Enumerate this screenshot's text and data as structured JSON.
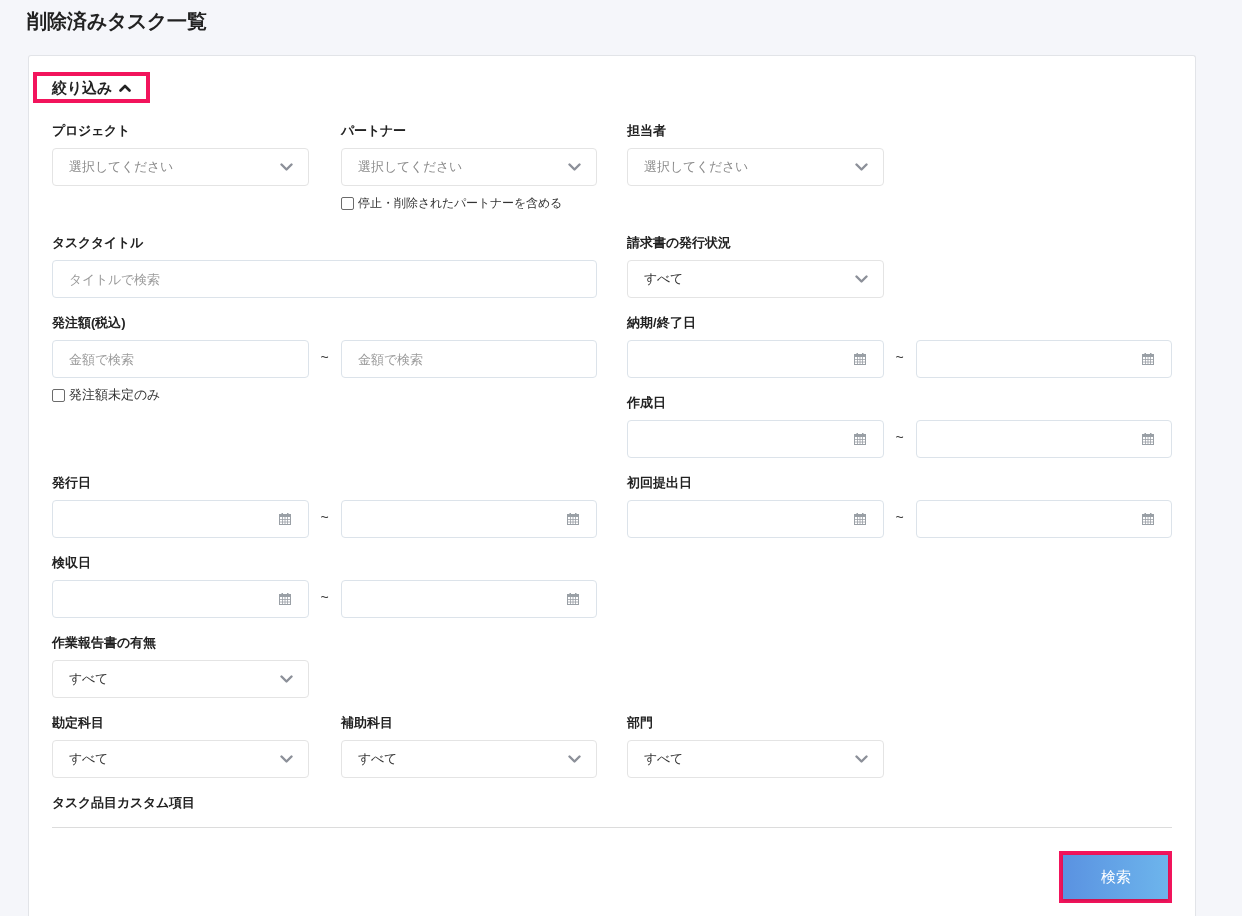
{
  "page_title": "削除済みタスク一覧",
  "filter_panel": {
    "toggle": {
      "label": "絞り込み",
      "expanded": true,
      "highlighted": true
    },
    "rows": [
      {
        "left": [
          {
            "kind": "select",
            "label": "プロジェクト",
            "placeholder": "選択してください"
          },
          {
            "kind": "select",
            "label": "パートナー",
            "placeholder": "選択してください",
            "option": {
              "label": "停止・削除されたパートナーを含める",
              "checked": false
            }
          }
        ],
        "right": [
          {
            "kind": "select",
            "label": "担当者",
            "placeholder": "選択してください"
          }
        ]
      },
      {
        "left": [
          {
            "kind": "text",
            "label": "タスクタイトル",
            "placeholder": "タイトルで検索"
          }
        ],
        "right": [
          {
            "kind": "select",
            "label": "請求書の発行状況",
            "value": "すべて"
          }
        ]
      },
      {
        "left": [
          {
            "kind": "text_range",
            "label": "発注額(税込)",
            "from_placeholder": "金額で検索",
            "separator": "~",
            "to_placeholder": "金額で検索",
            "option": {
              "label": "発注額未定のみ",
              "checked": false
            }
          }
        ],
        "right": [
          {
            "kind": "date_range",
            "label": "納期/終了日",
            "separator": "~"
          },
          {
            "kind": "date_range",
            "label": "作成日",
            "separator": "~"
          }
        ]
      },
      {
        "left": [
          {
            "kind": "date_range",
            "label": "発行日",
            "separator": "~"
          }
        ],
        "right": [
          {
            "kind": "date_range",
            "label": "初回提出日",
            "separator": "~"
          }
        ]
      },
      {
        "left": [
          {
            "kind": "date_range",
            "label": "検収日",
            "separator": "~"
          }
        ]
      },
      {
        "left": [
          {
            "kind": "select",
            "label": "作業報告書の有無",
            "value": "すべて"
          }
        ]
      },
      {
        "left": [
          {
            "kind": "select",
            "label": "勘定科目",
            "value": "すべて"
          },
          {
            "kind": "select",
            "label": "補助科目",
            "value": "すべて"
          }
        ],
        "right": [
          {
            "kind": "select",
            "label": "部門",
            "value": "すべて"
          }
        ]
      }
    ],
    "custom_fields_heading": "タスク品目カスタム項目",
    "search_button": {
      "label": "検索",
      "highlighted": true
    }
  }
}
